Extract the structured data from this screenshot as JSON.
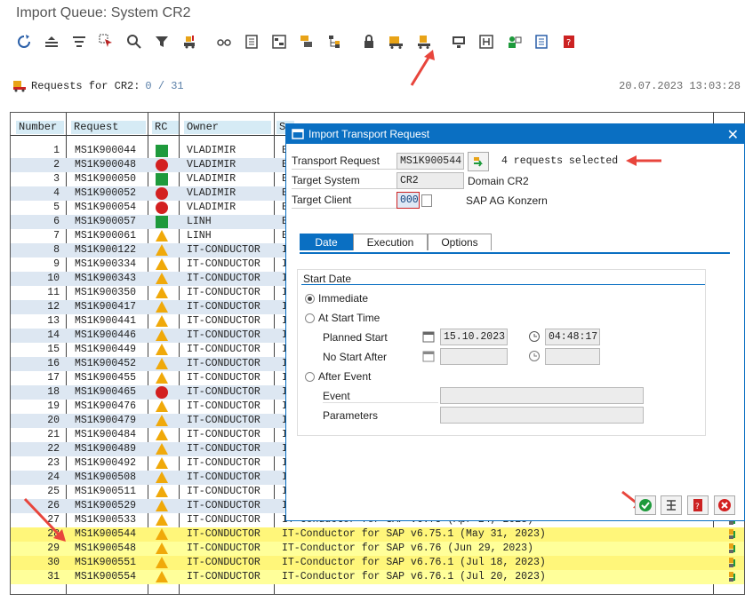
{
  "window": {
    "title": "Import Queue: System CR2"
  },
  "toolbar_icons": [
    "refresh-icon",
    "collapse-icon",
    "filter-lines-icon",
    "select-cursor-icon",
    "zoom-icon",
    "funnel-icon",
    "truck-import-icon",
    "glasses-icon",
    "document-list-icon",
    "layout-icon",
    "transport-icon",
    "hierarchy-icon",
    "lock-icon",
    "truck-all-icon",
    "truck-single-icon",
    "monitor-icon",
    "h-icon",
    "user-icon",
    "list-icon",
    "help-book-icon"
  ],
  "header": {
    "label": "Requests for CR2:",
    "count": "0 / 31",
    "datetime": "20.07.2023 13:03:28"
  },
  "columns": [
    "Number",
    "Request",
    "RC",
    "Owner",
    "S"
  ],
  "rows": [
    {
      "n": "1",
      "req": "MS1K900044",
      "rc": "green",
      "owner": "VLADIMIR",
      "short": "E"
    },
    {
      "n": "2",
      "req": "MS1K900048",
      "rc": "red",
      "owner": "VLADIMIR",
      "short": "E"
    },
    {
      "n": "3",
      "req": "MS1K900050",
      "rc": "green",
      "owner": "VLADIMIR",
      "short": "E"
    },
    {
      "n": "4",
      "req": "MS1K900052",
      "rc": "red",
      "owner": "VLADIMIR",
      "short": "E"
    },
    {
      "n": "5",
      "req": "MS1K900054",
      "rc": "red",
      "owner": "VLADIMIR",
      "short": "E"
    },
    {
      "n": "6",
      "req": "MS1K900057",
      "rc": "green",
      "owner": "LINH",
      "short": "E"
    },
    {
      "n": "7",
      "req": "MS1K900061",
      "rc": "yellow",
      "owner": "LINH",
      "short": "E"
    },
    {
      "n": "8",
      "req": "MS1K900122",
      "rc": "yellow",
      "owner": "IT-CONDUCTOR",
      "short": "I"
    },
    {
      "n": "9",
      "req": "MS1K900334",
      "rc": "yellow",
      "owner": "IT-CONDUCTOR",
      "short": "I"
    },
    {
      "n": "10",
      "req": "MS1K900343",
      "rc": "yellow",
      "owner": "IT-CONDUCTOR",
      "short": "I"
    },
    {
      "n": "11",
      "req": "MS1K900350",
      "rc": "yellow",
      "owner": "IT-CONDUCTOR",
      "short": "I"
    },
    {
      "n": "12",
      "req": "MS1K900417",
      "rc": "yellow",
      "owner": "IT-CONDUCTOR",
      "short": "I"
    },
    {
      "n": "13",
      "req": "MS1K900441",
      "rc": "yellow",
      "owner": "IT-CONDUCTOR",
      "short": "I"
    },
    {
      "n": "14",
      "req": "MS1K900446",
      "rc": "yellow",
      "owner": "IT-CONDUCTOR",
      "short": "I"
    },
    {
      "n": "15",
      "req": "MS1K900449",
      "rc": "yellow",
      "owner": "IT-CONDUCTOR",
      "short": "I"
    },
    {
      "n": "16",
      "req": "MS1K900452",
      "rc": "yellow",
      "owner": "IT-CONDUCTOR",
      "short": "I"
    },
    {
      "n": "17",
      "req": "MS1K900455",
      "rc": "yellow",
      "owner": "IT-CONDUCTOR",
      "short": "I"
    },
    {
      "n": "18",
      "req": "MS1K900465",
      "rc": "red",
      "owner": "IT-CONDUCTOR",
      "short": "I"
    },
    {
      "n": "19",
      "req": "MS1K900476",
      "rc": "yellow",
      "owner": "IT-CONDUCTOR",
      "short": "I"
    },
    {
      "n": "20",
      "req": "MS1K900479",
      "rc": "yellow",
      "owner": "IT-CONDUCTOR",
      "short": "I"
    },
    {
      "n": "21",
      "req": "MS1K900484",
      "rc": "yellow",
      "owner": "IT-CONDUCTOR",
      "short": "I"
    },
    {
      "n": "22",
      "req": "MS1K900489",
      "rc": "yellow",
      "owner": "IT-CONDUCTOR",
      "short": "I"
    },
    {
      "n": "23",
      "req": "MS1K900492",
      "rc": "yellow",
      "owner": "IT-CONDUCTOR",
      "short": "I"
    },
    {
      "n": "24",
      "req": "MS1K900508",
      "rc": "yellow",
      "owner": "IT-CONDUCTOR",
      "short": "I"
    },
    {
      "n": "25",
      "req": "MS1K900511",
      "rc": "yellow",
      "owner": "IT-CONDUCTOR",
      "short": "I"
    },
    {
      "n": "26",
      "req": "MS1K900529",
      "rc": "yellow",
      "owner": "IT-CONDUCTOR",
      "short": "I"
    },
    {
      "n": "27",
      "req": "MS1K900533",
      "rc": "yellow",
      "owner": "IT-CONDUCTOR",
      "short": "IT-Conductor for SAP v6.75 (Apr 24, 2023)"
    },
    {
      "n": "28",
      "req": "MS1K900544",
      "rc": "yellow",
      "owner": "IT-CONDUCTOR",
      "short": "IT-Conductor for SAP v6.75.1 (May 31, 2023)",
      "hl": "strong"
    },
    {
      "n": "29",
      "req": "MS1K900548",
      "rc": "yellow",
      "owner": "IT-CONDUCTOR",
      "short": "IT-Conductor for SAP v6.76 (Jun 29, 2023)",
      "hl": "light"
    },
    {
      "n": "30",
      "req": "MS1K900551",
      "rc": "yellow",
      "owner": "IT-CONDUCTOR",
      "short": "IT-Conductor for SAP v6.76.1 (Jul 18, 2023)",
      "hl": "strong"
    },
    {
      "n": "31",
      "req": "MS1K900554",
      "rc": "yellow",
      "owner": "IT-CONDUCTOR",
      "short": "IT-Conductor for SAP v6.76.1 (Jul 20, 2023)",
      "hl": "light"
    }
  ],
  "dialog": {
    "title": "Import Transport Request",
    "transport_request_label": "Transport Request",
    "transport_request_value": "MS1K900544",
    "selected_note": "4 requests selected",
    "target_system_label": "Target System",
    "target_system_value": "CR2",
    "target_system_desc": "Domain CR2",
    "target_client_label": "Target Client",
    "target_client_value": "000",
    "target_client_desc": "SAP AG Konzern",
    "tabs": [
      "Date",
      "Execution",
      "Options"
    ],
    "group_title": "Start Date",
    "radio_immediate": "Immediate",
    "radio_start_time": "At Start Time",
    "planned_start_label": "Planned Start",
    "planned_start_date": "15.10.2023",
    "planned_start_time": "04:48:17",
    "no_start_after_label": "No Start After",
    "radio_after_event": "After Event",
    "event_label": "Event",
    "parameters_label": "Parameters"
  },
  "colors": {
    "accent": "#0a6fc2",
    "header_cell": "#d6ebf5",
    "highlight": "#fff67a",
    "arrow": "#e8453c"
  }
}
